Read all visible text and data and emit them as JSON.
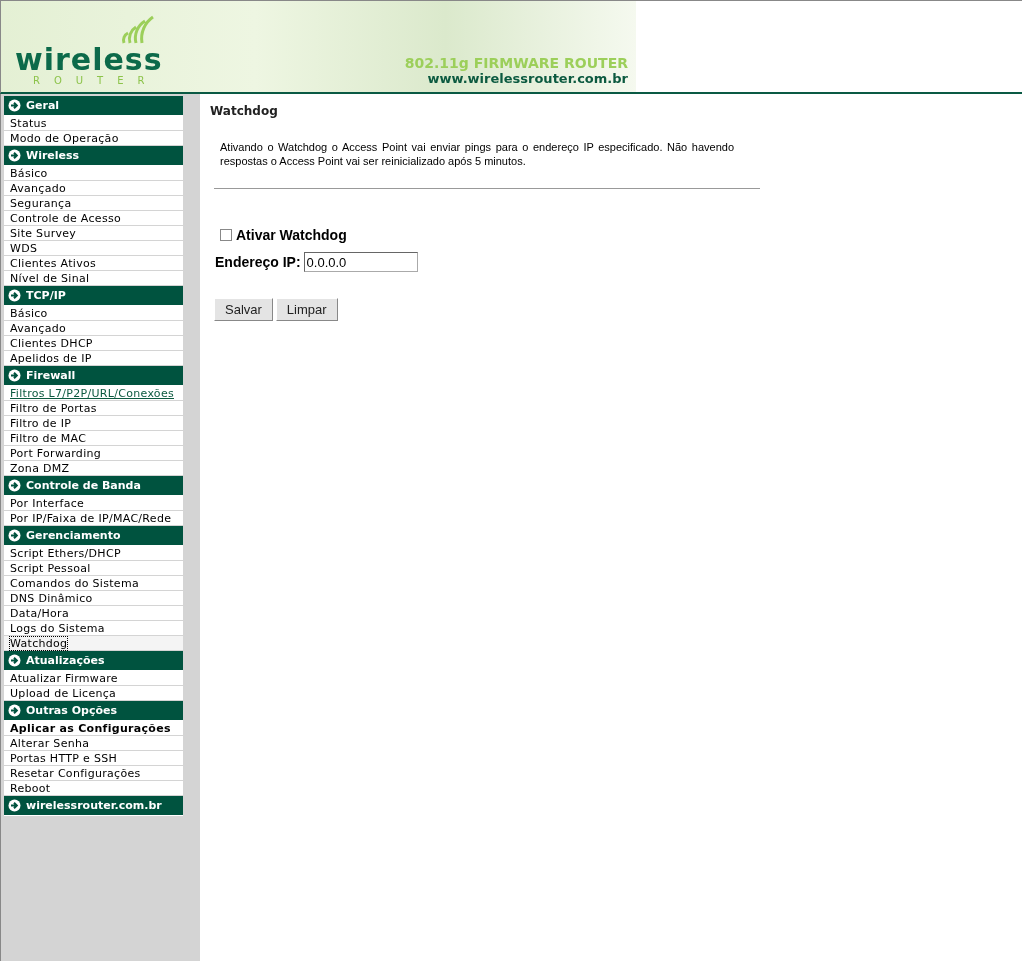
{
  "header": {
    "logo_word": "wireless",
    "logo_sub": "ROUTER",
    "tagline": "802.11g FIRMWARE ROUTER",
    "url": "www.wirelessrouter.com.br"
  },
  "sidebar": {
    "sections": [
      {
        "title": "Geral",
        "items": [
          {
            "label": "Status",
            "kind": "normal",
            "selected": false
          },
          {
            "label": "Modo de Operação",
            "kind": "normal",
            "selected": false
          }
        ]
      },
      {
        "title": "Wireless",
        "items": [
          {
            "label": "Básico",
            "kind": "normal",
            "selected": false
          },
          {
            "label": "Avançado",
            "kind": "normal",
            "selected": false
          },
          {
            "label": "Segurança",
            "kind": "normal",
            "selected": false
          },
          {
            "label": "Controle de Acesso",
            "kind": "normal",
            "selected": false
          },
          {
            "label": "Site Survey",
            "kind": "normal",
            "selected": false
          },
          {
            "label": "WDS",
            "kind": "normal",
            "selected": false
          },
          {
            "label": "Clientes Ativos",
            "kind": "normal",
            "selected": false
          },
          {
            "label": "Nível de Sinal",
            "kind": "normal",
            "selected": false
          }
        ]
      },
      {
        "title": "TCP/IP",
        "items": [
          {
            "label": "Básico",
            "kind": "normal",
            "selected": false
          },
          {
            "label": "Avançado",
            "kind": "normal",
            "selected": false
          },
          {
            "label": "Clientes DHCP",
            "kind": "normal",
            "selected": false
          },
          {
            "label": "Apelidos de IP",
            "kind": "normal",
            "selected": false
          }
        ]
      },
      {
        "title": "Firewall",
        "items": [
          {
            "label": "Filtros L7/P2P/URL/Conexões",
            "kind": "link",
            "selected": false
          },
          {
            "label": "Filtro de Portas",
            "kind": "normal",
            "selected": false
          },
          {
            "label": "Filtro de IP",
            "kind": "normal",
            "selected": false
          },
          {
            "label": "Filtro de MAC",
            "kind": "normal",
            "selected": false
          },
          {
            "label": "Port Forwarding",
            "kind": "normal",
            "selected": false
          },
          {
            "label": "Zona DMZ",
            "kind": "normal",
            "selected": false
          }
        ]
      },
      {
        "title": "Controle de Banda",
        "items": [
          {
            "label": "Por Interface",
            "kind": "normal",
            "selected": false
          },
          {
            "label": "Por IP/Faixa de IP/MAC/Rede",
            "kind": "normal",
            "selected": false
          }
        ]
      },
      {
        "title": "Gerenciamento",
        "items": [
          {
            "label": "Script Ethers/DHCP",
            "kind": "normal",
            "selected": false
          },
          {
            "label": "Script Pessoal",
            "kind": "normal",
            "selected": false
          },
          {
            "label": "Comandos do Sistema",
            "kind": "normal",
            "selected": false
          },
          {
            "label": "DNS Dinâmico",
            "kind": "normal",
            "selected": false
          },
          {
            "label": "Data/Hora",
            "kind": "normal",
            "selected": false
          },
          {
            "label": "Logs do Sistema",
            "kind": "normal",
            "selected": false
          },
          {
            "label": "Watchdog",
            "kind": "normal",
            "selected": true
          }
        ]
      },
      {
        "title": "Atualizações",
        "items": [
          {
            "label": "Atualizar Firmware",
            "kind": "normal",
            "selected": false
          },
          {
            "label": "Upload de Licença",
            "kind": "normal",
            "selected": false
          }
        ]
      },
      {
        "title": "Outras Opções",
        "items": [
          {
            "label": "Aplicar as Configurações",
            "kind": "bold",
            "selected": false
          },
          {
            "label": "Alterar Senha",
            "kind": "normal",
            "selected": false
          },
          {
            "label": "Portas HTTP e SSH",
            "kind": "normal",
            "selected": false
          },
          {
            "label": "Resetar Configurações",
            "kind": "normal",
            "selected": false
          },
          {
            "label": "Reboot",
            "kind": "normal",
            "selected": false
          }
        ]
      },
      {
        "title": "wirelessrouter.com.br"
      }
    ]
  },
  "content": {
    "title": "Watchdog",
    "description": "Ativando o Watchdog o Access Point vai enviar pings para o endereço IP especificado. Não havendo respostas o Access Point vai ser reinicializado após 5 minutos.",
    "checkbox": {
      "label": "Ativar Watchdog",
      "checked": false
    },
    "ip_field": {
      "label": "Endereço IP:",
      "value": "0.0.0.0"
    },
    "buttons": [
      "Salvar",
      "Limpar"
    ]
  }
}
